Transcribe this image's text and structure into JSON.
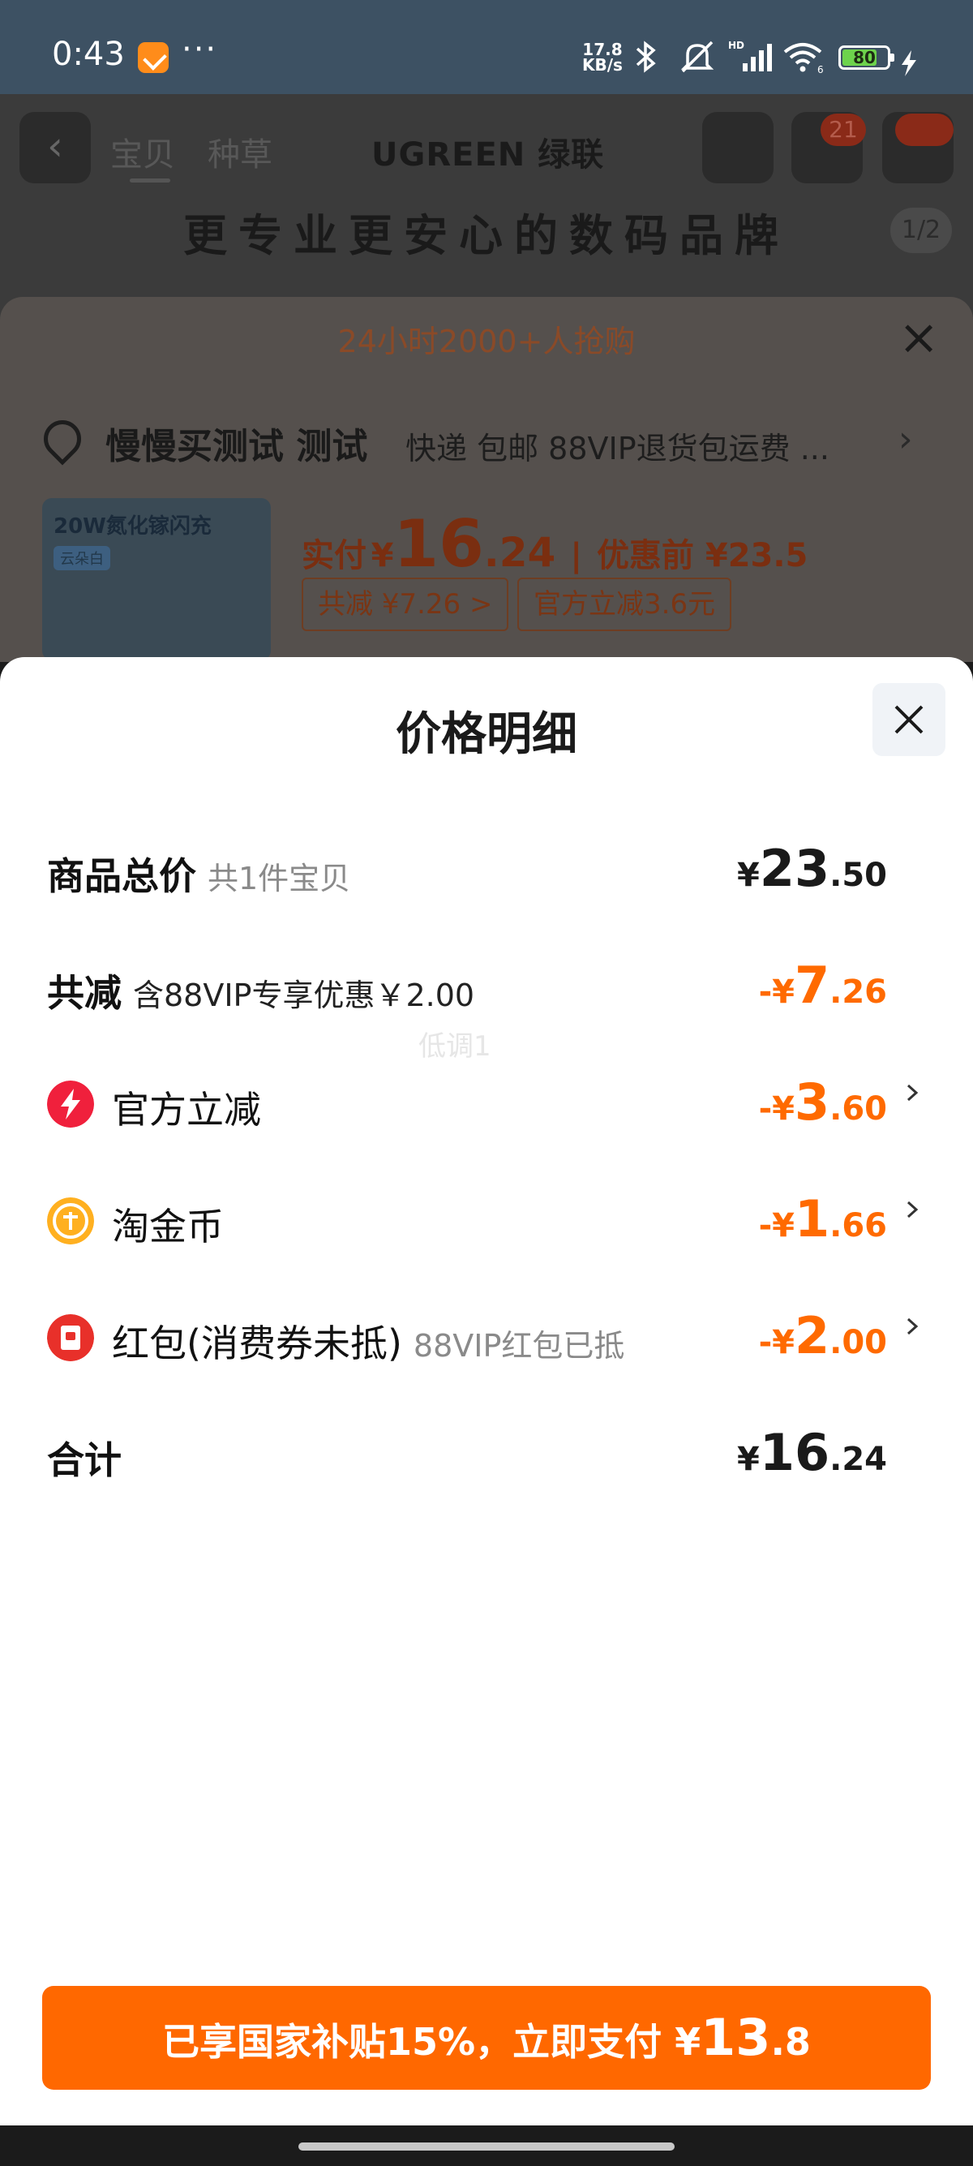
{
  "status_bar": {
    "time": "0:43",
    "more": "···",
    "net_speed_value": "17.8",
    "net_speed_unit": "KB/s",
    "battery_level": "80",
    "icons": [
      "bluetooth-icon",
      "mute-icon",
      "signal-icon",
      "wifi-icon",
      "battery-icon",
      "charging-icon"
    ]
  },
  "background_page": {
    "tabs": [
      "宝贝",
      "种草"
    ],
    "logo": "UGREEN 绿联",
    "cart_badge": "21",
    "slogan": "更专业更安心的数码品牌",
    "pager": "1/2",
    "banner": "24小时2000+人抢购",
    "address": "慢慢买测试 测试",
    "shipping": "快递 包邮 88VIP退货包运费 ...",
    "thumb_title": "20W氮化镓闪充",
    "thumb_tag": "云朵白",
    "price_label": "实付",
    "price_currency": "¥",
    "price_int": "16",
    "price_dec": ".24",
    "price_before": "优惠前 ¥23.5",
    "chip_total_discount": "共减 ¥7.26 >",
    "chip_official": "官方立减3.6元"
  },
  "sheet": {
    "title": "价格明细",
    "watermark": "低调1",
    "rows": {
      "total": {
        "label": "商品总价",
        "sub": "共1件宝贝",
        "cur": "¥",
        "int": "23",
        "dec": ".50"
      },
      "discount": {
        "label": "共减",
        "sub": "含88VIP专享优惠￥2.00",
        "cur": "-¥",
        "int": "7",
        "dec": ".26"
      },
      "official": {
        "label": "官方立减",
        "cur": "-¥",
        "int": "3",
        "dec": ".60"
      },
      "coins": {
        "label": "淘金币",
        "cur": "-¥",
        "int": "1",
        "dec": ".66"
      },
      "redpacket": {
        "label": "红包(消费券未抵)",
        "sub": "88VIP红包已抵",
        "cur": "-¥",
        "int": "2",
        "dec": ".00"
      },
      "sum": {
        "label": "合计",
        "cur": "¥",
        "int": "16",
        "dec": ".24"
      }
    }
  },
  "pay_button": {
    "prefix": "已享国家补贴15%，立即支付 ¥",
    "amount_int": "13",
    "amount_dec": ".8"
  },
  "colors": {
    "accent": "#ff6a00",
    "status_bar": "#3d5163",
    "official_icon": "#f0203c",
    "coin_icon": "#ffb020",
    "redpacket_icon": "#e8302a"
  }
}
